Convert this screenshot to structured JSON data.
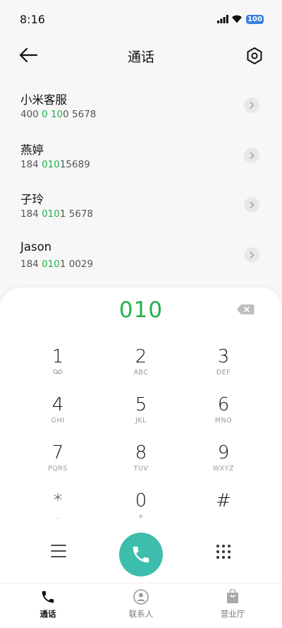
{
  "status": {
    "time": "8:16",
    "battery": "100"
  },
  "header": {
    "title": "通话"
  },
  "contacts": [
    {
      "name": "小米客服",
      "num_pre": "400 ",
      "num_hl1": "",
      "num_mid": "",
      "num_parts": [
        "400 ",
        "0",
        " ",
        "10",
        "0 5678"
      ]
    },
    {
      "name": "燕婷",
      "num_parts": [
        "184 ",
        "010",
        "15689"
      ]
    },
    {
      "name": "子玲",
      "num_parts": [
        "184 ",
        "010",
        "1 5678"
      ]
    },
    {
      "name": "Jason",
      "num_parts": [
        "184 ",
        "010",
        "1 0029"
      ]
    }
  ],
  "dialpad": {
    "typed": "010",
    "keys": [
      {
        "digit": "1",
        "sub": ""
      },
      {
        "digit": "2",
        "sub": "ABC"
      },
      {
        "digit": "3",
        "sub": "DEF"
      },
      {
        "digit": "4",
        "sub": "GHI"
      },
      {
        "digit": "5",
        "sub": "JKL"
      },
      {
        "digit": "6",
        "sub": "MNO"
      },
      {
        "digit": "7",
        "sub": "PQRS"
      },
      {
        "digit": "8",
        "sub": "TUV"
      },
      {
        "digit": "9",
        "sub": "WXYZ"
      },
      {
        "digit": "*",
        "sub": ","
      },
      {
        "digit": "0",
        "sub": "+"
      },
      {
        "digit": "#",
        "sub": ""
      }
    ]
  },
  "tabs": [
    {
      "label": "通话"
    },
    {
      "label": "联系人"
    },
    {
      "label": "营业厅"
    }
  ],
  "colors": {
    "accent": "#22b14c",
    "call": "#3dbdac"
  }
}
